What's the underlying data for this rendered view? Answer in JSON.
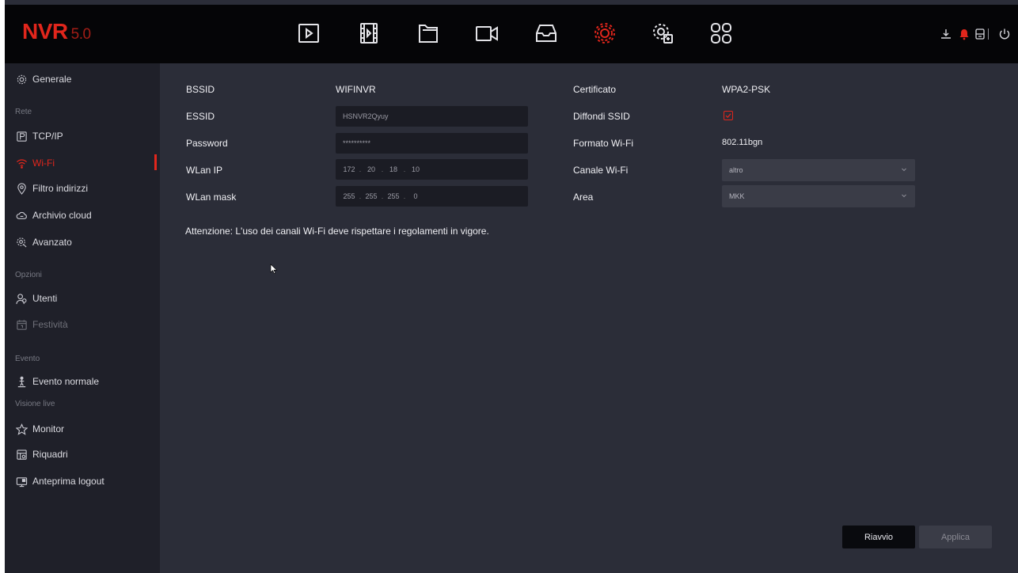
{
  "app": {
    "logo_main": "NVR",
    "logo_version": "5.0"
  },
  "toolbar": {
    "icons": [
      "playback-icon",
      "video-clips-icon",
      "files-icon",
      "camera-icon",
      "storage-icon",
      "settings-icon",
      "advanced-settings-icon",
      "apps-icon"
    ],
    "active": "settings-icon",
    "right_icons": [
      "download-icon",
      "alarm-bell-icon",
      "disk-icon",
      "power-icon"
    ]
  },
  "sidebar": {
    "general": "Generale",
    "section_network": "Rete",
    "tcpip": "TCP/IP",
    "wifi": "Wi-Fi",
    "filter": "Filtro indirizzi",
    "cloud": "Archivio cloud",
    "advanced": "Avanzato",
    "section_options": "Opzioni",
    "users": "Utenti",
    "holidays": "Festività",
    "section_event": "Evento",
    "normal_event": "Evento normale",
    "section_live": "Visione live",
    "monitor": "Monitor",
    "layouts": "Riquadri",
    "logout_preview": "Anteprima logout"
  },
  "form": {
    "bssid_label": "BSSID",
    "bssid_value": "WIFINVR",
    "essid_label": "ESSID",
    "essid_value": "HSNVR2Qyuy",
    "password_label": "Password",
    "password_value": "**********",
    "ip_label": "WLan IP",
    "ip": [
      "172",
      "20",
      "18",
      "10"
    ],
    "mask_label": "WLan mask",
    "mask": [
      "255",
      "255",
      "255",
      "0"
    ],
    "cert_label": "Certificato",
    "cert_value": "WPA2-PSK",
    "broadcast_label": "Diffondi SSID",
    "broadcast_checked": true,
    "format_label": "Formato Wi-Fi",
    "format_value": "802.11bgn",
    "channel_label": "Canale Wi-Fi",
    "channel_value": "altro",
    "area_label": "Area",
    "area_value": "MKK",
    "notice": "Attenzione: L'uso dei canali Wi-Fi deve rispettare i regolamenti in vigore."
  },
  "buttons": {
    "reboot": "Riavvio",
    "apply": "Applica"
  },
  "colors": {
    "accent": "#e1261c",
    "background": "#2b2d38",
    "sidebar": "#1f2029",
    "topbar": "#050507"
  }
}
